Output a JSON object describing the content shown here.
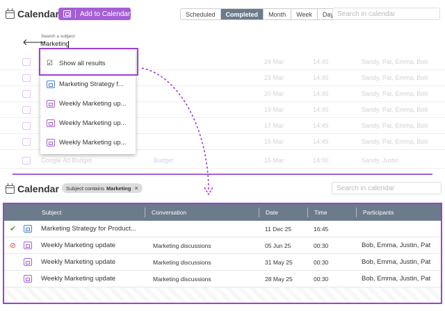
{
  "top": {
    "title": "Calendar",
    "add_button": "Add to Calendar",
    "view_tabs": [
      "Scheduled",
      "Completed",
      "Month",
      "Week",
      "Day"
    ],
    "active_tab": "Completed",
    "search_placeholder": "Search in calendar",
    "subject_search": {
      "label": "Search a subject",
      "value": "Marketing"
    },
    "dropdown": {
      "show_all": "Show all results",
      "items": [
        "Marketing Strategy f...",
        "Weekly Marketing up...",
        "Weekly Marketing up...",
        "Weekly Marketing up..."
      ]
    },
    "background_rows": [
      {
        "date": "24 Mar",
        "time": "14:45",
        "people": "Sandy, Pat, Emma, Bob"
      },
      {
        "date": "23 Mar",
        "time": "14:45",
        "people": "Sandy, Pat, Emma, Bob"
      },
      {
        "date": "20 Mar",
        "time": "14:45",
        "people": "Sandy, Pat, Emma, Bob"
      },
      {
        "date": "19 Mar",
        "time": "14:45",
        "people": "Sandy, Pat, Emma, Bob"
      },
      {
        "date": "17 Mar",
        "time": "14:45",
        "people": "Sandy, Pat, Emma, Bob"
      },
      {
        "date": "16 Mar",
        "time": "14:45",
        "people": "Sandy, Pat, Emma, Bob"
      },
      {
        "subject": "Google Ad Budget",
        "conversation": "Budget",
        "date": "15 Mar",
        "time": "14:00",
        "people": "Sandy, Justin"
      }
    ]
  },
  "bottom": {
    "title": "Calendar",
    "filter_chip": {
      "prefix": "Subject contains",
      "value": "Marketing",
      "close": "×"
    },
    "search_placeholder": "Search in calendar",
    "columns": [
      "Subject",
      "Conversation",
      "Date",
      "Time",
      "Participants"
    ],
    "rows": [
      {
        "status": "done",
        "status_glyph": "✔",
        "subject": "Marketing Strategy for Product...",
        "conversation": "",
        "date": "11 Dec 25",
        "time": "16:45",
        "participants": ""
      },
      {
        "status": "cancelled",
        "status_glyph": "⊘",
        "subject": "Weekly Marketing update",
        "conversation": "Marketing discussions",
        "date": "05 Jun 25",
        "time": "00:30",
        "participants": "Bob, Emma, Justin, Pat"
      },
      {
        "status": "none",
        "status_glyph": "",
        "subject": "Weekly Marketing update",
        "conversation": "Marketing discussions",
        "date": "31 May 25",
        "time": "00:30",
        "participants": "Bob, Emma, Justin, Pat"
      },
      {
        "status": "none",
        "status_glyph": "",
        "subject": "Weekly Marketing update",
        "conversation": "Marketing discussions",
        "date": "28 May 25",
        "time": "00:30",
        "participants": "Bob, Emma, Justin, Pat"
      }
    ]
  },
  "colors": {
    "accent": "#a55fd6",
    "highlight": "#9b3fd6",
    "header_bg": "#6b7b8b",
    "success": "#3aa63a",
    "danger": "#d9534f"
  }
}
